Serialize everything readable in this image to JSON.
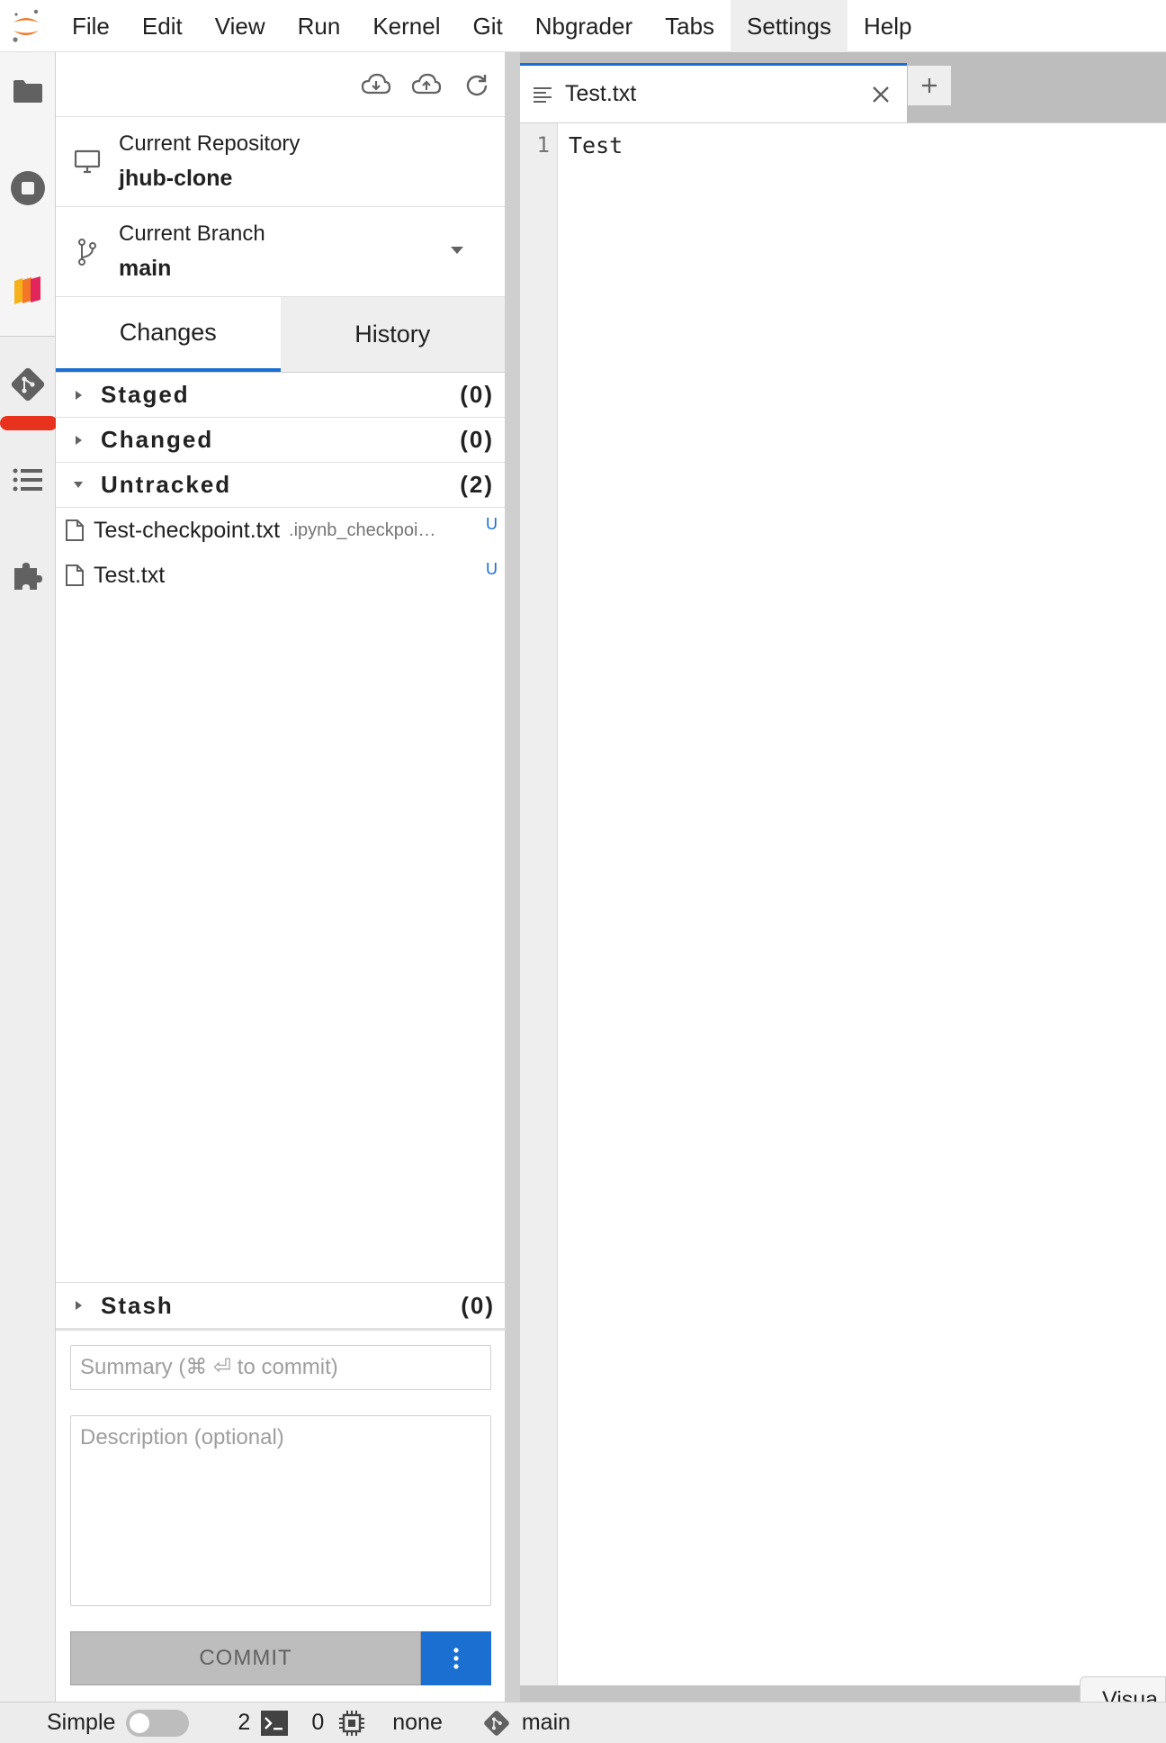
{
  "menu": {
    "items": [
      {
        "label": "File"
      },
      {
        "label": "Edit"
      },
      {
        "label": "View"
      },
      {
        "label": "Run"
      },
      {
        "label": "Kernel"
      },
      {
        "label": "Git"
      },
      {
        "label": "Nbgrader"
      },
      {
        "label": "Tabs"
      },
      {
        "label": "Settings"
      },
      {
        "label": "Help"
      }
    ],
    "active": "Settings"
  },
  "activity_bar": {
    "icons": [
      "folder-icon",
      "stop-circle-icon",
      "extension-stack-icon",
      "git-icon",
      "list-icon",
      "puzzle-icon"
    ]
  },
  "git": {
    "toolbar_icons": [
      "cloud-download-icon",
      "cloud-upload-icon",
      "refresh-icon"
    ],
    "repo": {
      "label": "Current Repository",
      "value": "jhub-clone"
    },
    "branch": {
      "label": "Current Branch",
      "value": "main"
    },
    "tabs": [
      {
        "label": "Changes",
        "active": true
      },
      {
        "label": "History",
        "active": false
      }
    ],
    "sections": {
      "staged": {
        "title": "Staged",
        "count": "(0)"
      },
      "changed": {
        "title": "Changed",
        "count": "(0)"
      },
      "untracked": {
        "title": "Untracked",
        "count": "(2)"
      },
      "stash": {
        "title": "Stash",
        "count": "(0)"
      }
    },
    "untracked_files": [
      {
        "name": "Test-checkpoint.txt",
        "path": ".ipynb_checkpoints",
        "status": "U"
      },
      {
        "name": "Test.txt",
        "path": "",
        "status": "U"
      }
    ],
    "commit": {
      "summary_placeholder": "Summary (⌘ ⏎ to commit)",
      "description_placeholder": "Description (optional)",
      "button_label": "COMMIT"
    }
  },
  "editor": {
    "tab_name": "Test.txt",
    "new_tab_glyph": "+",
    "lines": [
      {
        "num": "1",
        "text": "Test"
      }
    ]
  },
  "visual_button": {
    "label": "Visua"
  },
  "statusbar": {
    "mode_label": "Simple",
    "terminals_count": "2",
    "kernels_count": "0",
    "kernel_name": "none",
    "branch": "main"
  },
  "colors": {
    "accent": "#1a6fd1",
    "marker": "#e8321e",
    "jupyter_orange": "#f37726"
  }
}
